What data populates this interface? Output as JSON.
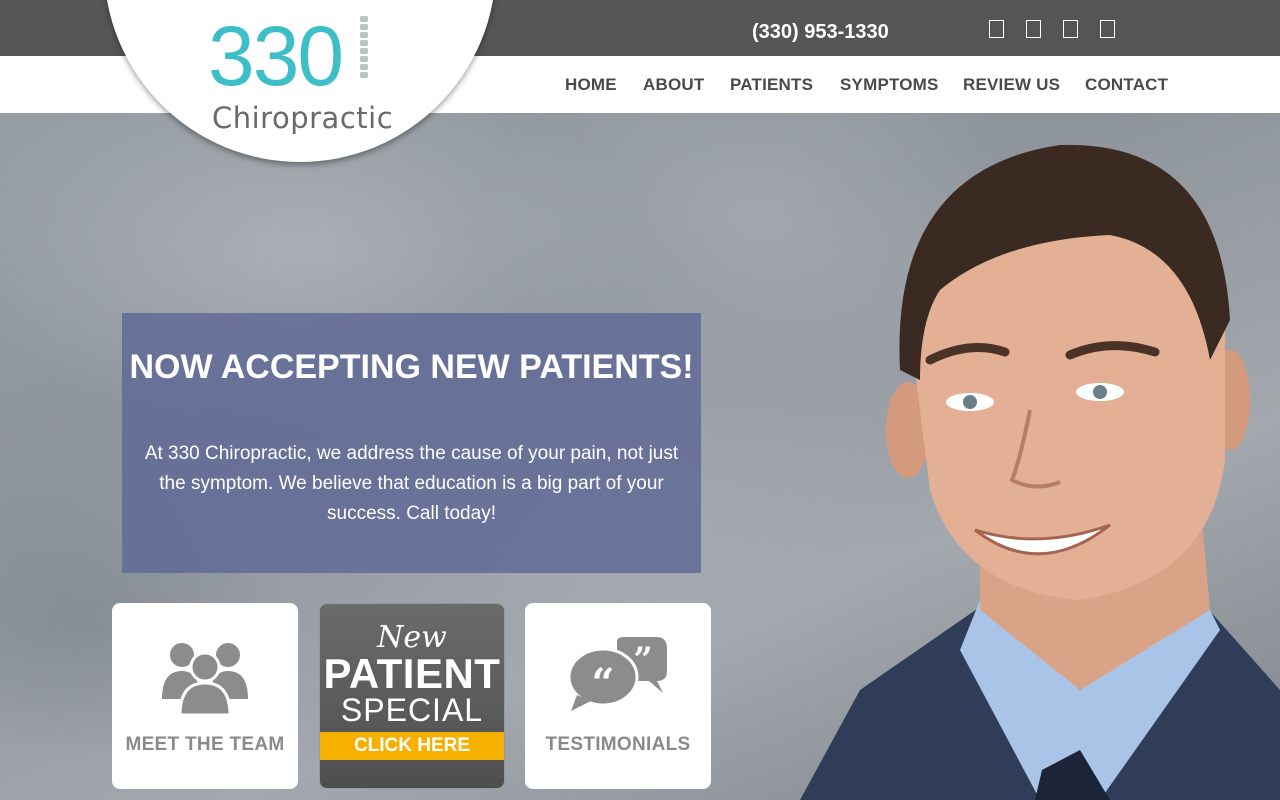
{
  "header": {
    "phone": "(330) 953-1330",
    "social_icons": [
      "facebook-icon",
      "twitter-icon",
      "google-icon",
      "youtube-icon"
    ]
  },
  "logo": {
    "number": "330",
    "word": "Chiropractic"
  },
  "nav": {
    "items": [
      "HOME",
      "ABOUT",
      "PATIENTS",
      "SYMPTOMS",
      "REVIEW US",
      "CONTACT"
    ]
  },
  "hero": {
    "title": "NOW ACCEPTING NEW PATIENTS!",
    "text": "At 330 Chiropractic, we address the cause of your pain, not just the symptom. We believe that education is a big part of your success. Call today!"
  },
  "cards": {
    "team_label": "MEET THE TEAM",
    "special_new": "New",
    "special_patient": "PATIENT",
    "special_special": "SPECIAL",
    "special_click": "CLICK HERE",
    "testimonials_label": "TESTIMONIALS"
  },
  "colors": {
    "brand_teal": "#3ebfc7",
    "topbar": "#555556",
    "info_box": "#606a96",
    "special_button": "#f6b000"
  }
}
